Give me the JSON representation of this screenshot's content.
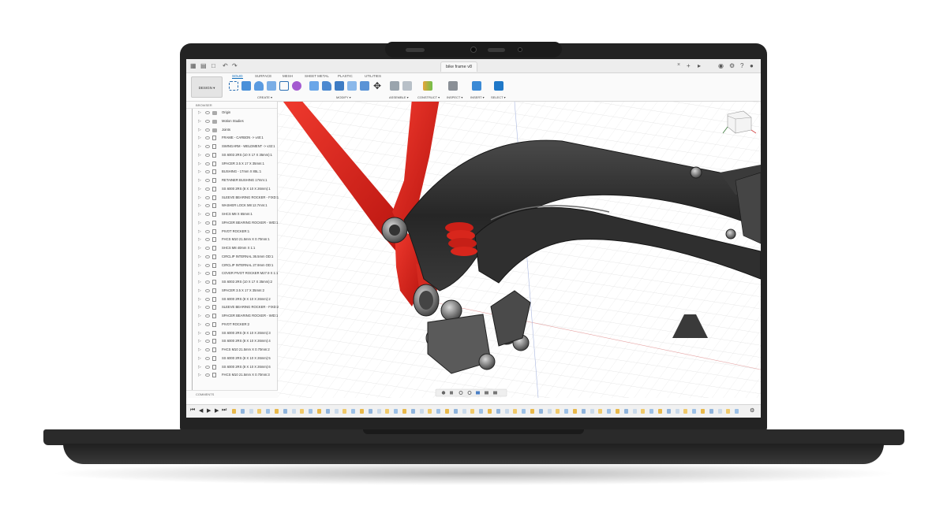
{
  "app": {
    "document_title": "bike frame v8",
    "workspace_button": "DESIGN ▾"
  },
  "ribbon": {
    "tabs": [
      "SOLID",
      "SURFACE",
      "MESH",
      "SHEET METAL",
      "PLASTIC",
      "UTILITIES"
    ],
    "active_tab": "SOLID",
    "groups": [
      "CREATE ▾",
      "MODIFY ▾",
      "ASSEMBLE ▾",
      "CONSTRUCT ▾",
      "INSPECT ▾",
      "INSERT ▾",
      "SELECT ▾"
    ]
  },
  "browser": {
    "header": "BROWSER",
    "items": [
      {
        "label": "Origin",
        "kind": "folder"
      },
      {
        "label": "Motion Studies",
        "kind": "folder"
      },
      {
        "label": "Joints",
        "kind": "folder"
      },
      {
        "label": "FRAME - CARBON -> v40:1",
        "kind": "component"
      },
      {
        "label": "SWINGARM - WELDMENT -> v32:1",
        "kind": "component"
      },
      {
        "label": "SS 6003 2RS (10 X 17 X 35mm):1",
        "kind": "component"
      },
      {
        "label": "SPACER 3.5 X 17 X 35mm:1",
        "kind": "component"
      },
      {
        "label": "BUSHING - 17mm X 85L:1",
        "kind": "component"
      },
      {
        "label": "RETAINER BUSHING 17mm:1",
        "kind": "component"
      },
      {
        "label": "SS 6000 2RS (8 X 10 X 26mm):1",
        "kind": "component"
      },
      {
        "label": "SLEEVE BEARING ROCKER - FIXD:1",
        "kind": "component"
      },
      {
        "label": "WASHER LOCK M8 12.7mm:1",
        "kind": "component"
      },
      {
        "label": "SHCS M8 X 65mm:1",
        "kind": "component"
      },
      {
        "label": "SPACER BEARING ROCKER - WID:1",
        "kind": "component"
      },
      {
        "label": "PIVOT ROCKER:1",
        "kind": "component"
      },
      {
        "label": "FHCS M10 21.5mm X 0.70mm:1",
        "kind": "component"
      },
      {
        "label": "SHCS M8 40mm X 1:1",
        "kind": "component"
      },
      {
        "label": "CIRCLIP INTERNAL 36.5mm OD:1",
        "kind": "component"
      },
      {
        "label": "CIRCLIP INTERNAL 27.9mm OD:1",
        "kind": "component"
      },
      {
        "label": "COVER PIVOT ROCKER M27.9 X 1:1",
        "kind": "component"
      },
      {
        "label": "SS 6003 2RS (10 X 17 X 35mm):2",
        "kind": "component"
      },
      {
        "label": "SPACER 3.5 X 17 X 35mm:2",
        "kind": "component"
      },
      {
        "label": "SS 6000 2RS (8 X 10 X 26mm):2",
        "kind": "component"
      },
      {
        "label": "SLEEVE BEARING ROCKER - FIXD:2",
        "kind": "component"
      },
      {
        "label": "SPACER BEARING ROCKER - WID:1",
        "kind": "component"
      },
      {
        "label": "PIVOT ROCKER:2",
        "kind": "component"
      },
      {
        "label": "SS 6000 2RS (8 X 10 X 26mm):3",
        "kind": "component"
      },
      {
        "label": "SS 6000 2RS (8 X 10 X 26mm):4",
        "kind": "component"
      },
      {
        "label": "FHCS M10 21.5mm X 0.70mm:2",
        "kind": "component"
      },
      {
        "label": "SS 6000 2RS (8 X 10 X 26mm):5",
        "kind": "component"
      },
      {
        "label": "SS 6000 2RS (8 X 10 X 26mm):6",
        "kind": "component"
      },
      {
        "label": "FHCS M10 21.5mm X 0.70mm:3",
        "kind": "component"
      }
    ]
  },
  "comments_label": "COMMENTS",
  "colors": {
    "frame_red": "#e0231c",
    "carbon_dark": "#2c2c2c",
    "accent_blue": "#0b6ab8"
  }
}
